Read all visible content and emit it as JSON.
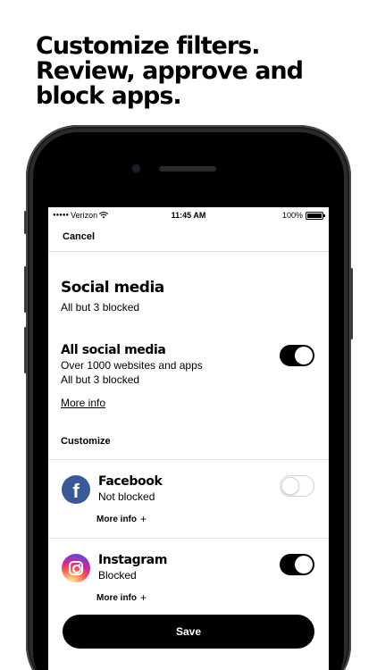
{
  "headline": {
    "line1": "Customize filters.",
    "line2": "Review, approve and",
    "line3": "block apps."
  },
  "statusbar": {
    "carrier": "Verizon",
    "time": "11:45 AM",
    "battery": "100%",
    "signal_dots": "●●●●●"
  },
  "nav": {
    "cancel_label": "Cancel"
  },
  "section": {
    "title": "Social media",
    "subtitle": "All but 3 blocked"
  },
  "all_social": {
    "title": "All social media",
    "line1": "Over 1000 websites and apps",
    "line2": "All but 3 blocked",
    "more_info": "More info",
    "toggle_on": true
  },
  "customize_label": "Customize",
  "apps": [
    {
      "name": "Facebook",
      "status": "Not blocked",
      "more": "More info",
      "toggle_on": false
    },
    {
      "name": "Instagram",
      "status": "Blocked",
      "more": "More info",
      "toggle_on": true
    }
  ],
  "save_label": "Save",
  "colors": {
    "accent": "#000000",
    "facebook": "#3b5998",
    "divider": "#e2e2e2"
  }
}
